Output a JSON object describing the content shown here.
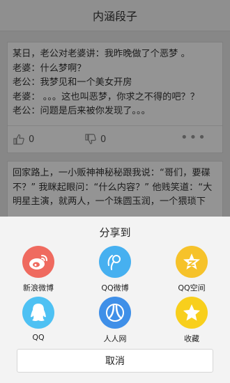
{
  "header": {
    "title": "内涵段子"
  },
  "posts": [
    {
      "lines": [
        "某日，老公对老婆讲：我昨晚做了个恶梦 。",
        "老婆：什么梦啊？",
        "老公：我梦见和一个美女开房",
        "老婆： 。。。这也叫恶梦，你求之不得的吧？？",
        "老公：问题是后来被你发现了。。。"
      ],
      "likes": "0",
      "dislikes": "0",
      "more": "•••"
    },
    {
      "lines": [
        "回家路上，一小贩神神秘秘跟我说：“哥们，要碟",
        "不？” 我眯起眼问：“什么内容？” 他贱笑道：“大",
        "明星主演，就两人，一个珠圆玉润，一个猥琐下"
      ]
    }
  ],
  "share_sheet": {
    "title": "分享到",
    "targets": [
      {
        "label": "新浪微博",
        "icon": "weibo-icon",
        "color": "#ef6a5f"
      },
      {
        "label": "QQ微博",
        "icon": "tencent-weibo-icon",
        "color": "#46b0f0"
      },
      {
        "label": "QQ空间",
        "icon": "qzone-icon",
        "color": "#f6c22a"
      },
      {
        "label": "QQ",
        "icon": "qq-icon",
        "color": "#4ec1f3"
      },
      {
        "label": "人人网",
        "icon": "renren-icon",
        "color": "#3f8fe8"
      },
      {
        "label": "收藏",
        "icon": "favorite-star-icon",
        "color": "#f8cf1c"
      }
    ],
    "cancel_label": "取消"
  }
}
